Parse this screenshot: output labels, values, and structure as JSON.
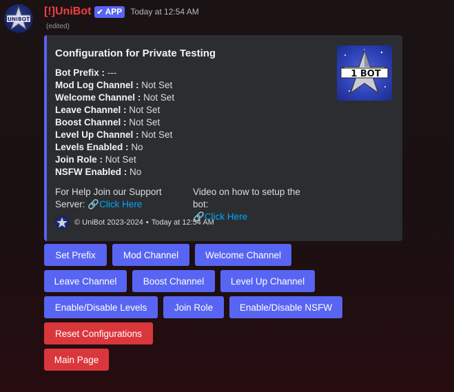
{
  "message": {
    "username": "[!]UniBot",
    "badge": "APP",
    "badge_icon": "checkmark-icon",
    "timestamp": "Today at 12:54 AM",
    "edited": "(edited)"
  },
  "embed": {
    "accent_color": "#5865f2",
    "title": "Configuration for Private Testing",
    "fields": [
      {
        "label": "Bot Prefix :",
        "value": " ---"
      },
      {
        "label": "Mod Log Channel :",
        "value": "Not Set"
      },
      {
        "label": "Welcome Channel :",
        "value": "Not Set"
      },
      {
        "label": "Leave Channel :",
        "value": "Not Set"
      },
      {
        "label": "Boost Channel :",
        "value": "Not Set"
      },
      {
        "label": "Level Up Channel :",
        "value": "Not Set"
      },
      {
        "label": "Levels Enabled :",
        "value": "No"
      },
      {
        "label": "Join Role :",
        "value": "Not Set"
      },
      {
        "label": "NSFW Enabled :",
        "value": "No"
      }
    ],
    "help": {
      "text": "For Help Join our Support Server:",
      "link_icon": "link-icon",
      "link": "Click Here"
    },
    "video": {
      "text": "Video on how to setup the bot:",
      "link_icon": "link-icon",
      "link": "Click Here"
    },
    "footer": {
      "text": "© UniBot 2023-2024",
      "separator": "•",
      "time": "Today at 12:54 AM"
    }
  },
  "buttons": {
    "set_prefix": "Set Prefix",
    "mod_channel": "Mod Channel",
    "welcome_channel": "Welcome Channel",
    "leave_channel": "Leave Channel",
    "boost_channel": "Boost Channel",
    "level_up_channel": "Level Up Channel",
    "toggle_levels": "Enable/Disable Levels",
    "join_role": "Join Role",
    "toggle_nsfw": "Enable/Disable NSFW",
    "reset": "Reset Configurations",
    "main_page": "Main Page"
  },
  "colors": {
    "primary_button": "#5865f2",
    "danger_button": "#da373c",
    "username": "#f23f43",
    "link": "#00a8fc"
  }
}
